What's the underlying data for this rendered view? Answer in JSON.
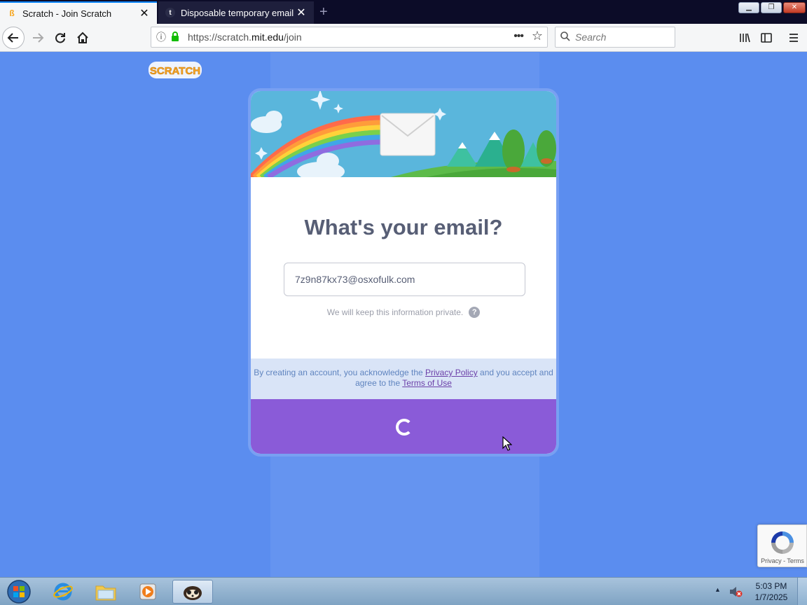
{
  "browser": {
    "tabs": [
      {
        "label": "Scratch - Join Scratch",
        "active": true
      },
      {
        "label": "Disposable temporary email - T",
        "active": false
      }
    ],
    "url": {
      "prefix": "https://scratch.",
      "domain": "mit.edu",
      "path": "/join"
    },
    "search_placeholder": "Search"
  },
  "page": {
    "logo_text": "SCRATCH",
    "title": "What's your email?",
    "email_value": "7z9n87kx73@osxofulk.com",
    "privacy_note": "We will keep this information private.",
    "legal": {
      "part1": "By creating an account, you acknowledge the ",
      "privacy_link": "Privacy Policy",
      "part2": " and you accept and agree to the ",
      "terms_link": "Terms of Use"
    },
    "recaptcha_text": "Privacy - Terms",
    "colors": {
      "background": "#5b8def",
      "submit": "#8a5bd8",
      "title": "#575e75"
    }
  },
  "taskbar": {
    "time": "5:03 PM",
    "date": "1/7/2025"
  }
}
